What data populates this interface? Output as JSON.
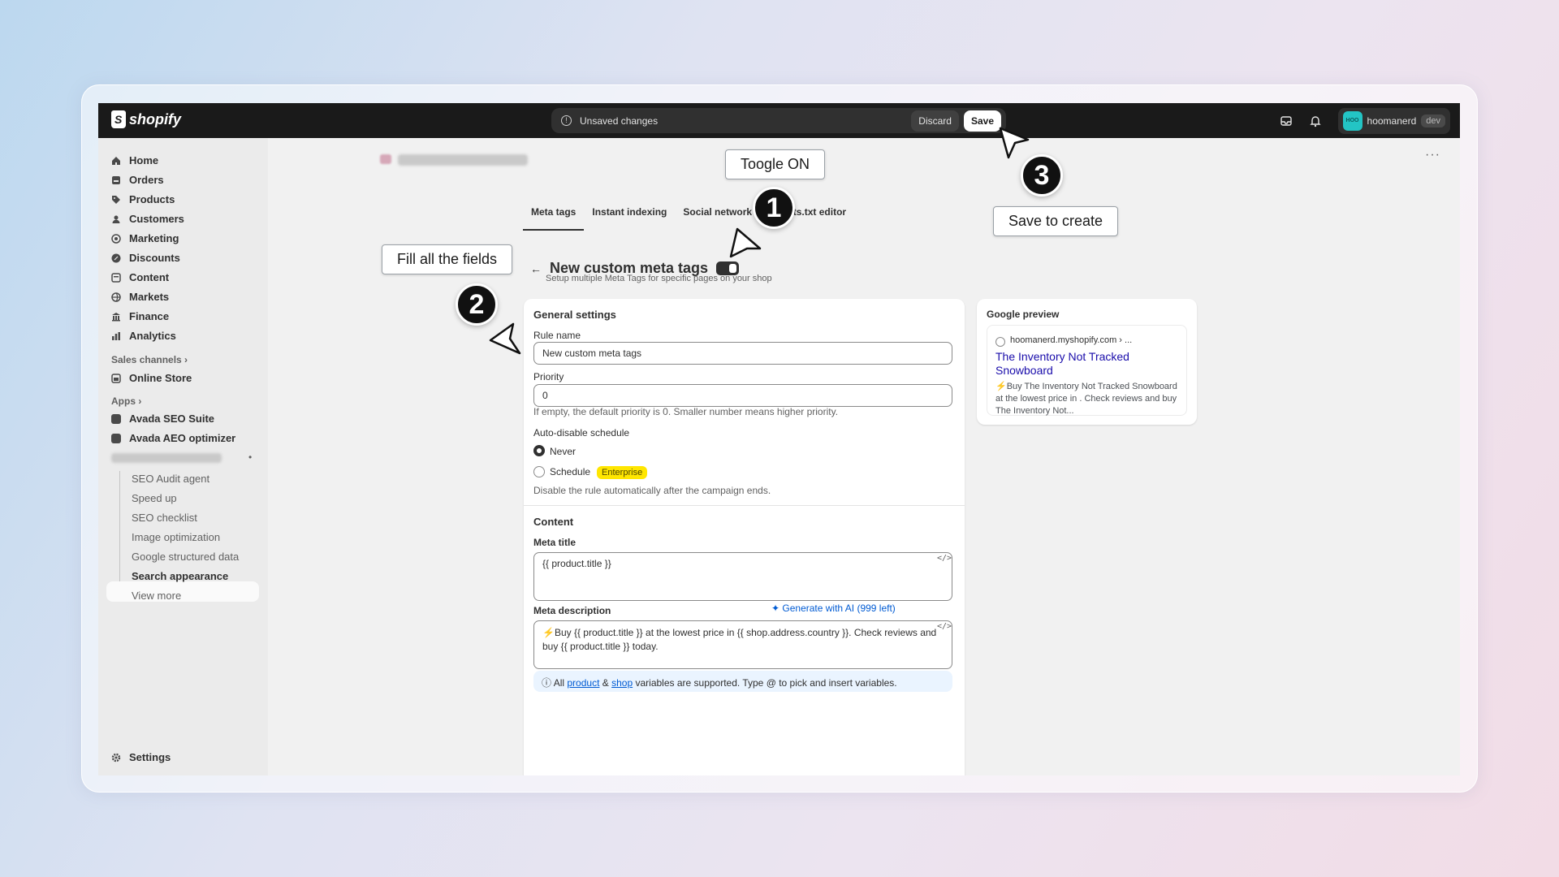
{
  "topbar": {
    "brand": "shopify",
    "unsaved_text": "Unsaved changes",
    "discard_label": "Discard",
    "save_label": "Save",
    "user_name": "hoomanerd",
    "user_badge": "dev",
    "avatar_initials": "HOO"
  },
  "sidebar": {
    "items": [
      {
        "label": "Home",
        "icon": "home-icon"
      },
      {
        "label": "Orders",
        "icon": "inbox-icon"
      },
      {
        "label": "Products",
        "icon": "tag-icon"
      },
      {
        "label": "Customers",
        "icon": "person-icon"
      },
      {
        "label": "Marketing",
        "icon": "target-icon"
      },
      {
        "label": "Discounts",
        "icon": "discount-icon"
      },
      {
        "label": "Content",
        "icon": "content-icon"
      },
      {
        "label": "Markets",
        "icon": "globe-icon"
      },
      {
        "label": "Finance",
        "icon": "bank-icon"
      },
      {
        "label": "Analytics",
        "icon": "chart-icon"
      }
    ],
    "sales_channels_header": "Sales channels",
    "online_store": "Online Store",
    "apps_header": "Apps",
    "apps": [
      "Avada SEO Suite",
      "Avada AEO optimizer"
    ],
    "sub_items": [
      "SEO Audit agent",
      "Speed up",
      "SEO checklist",
      "Image optimization",
      "Google structured data",
      "Search appearance",
      "View more"
    ],
    "settings": "Settings"
  },
  "tabs": [
    "Meta tags",
    "Instant indexing",
    "Social network",
    "Robots.txt editor"
  ],
  "page": {
    "title": "New custom meta tags",
    "subtitle": "Setup multiple Meta Tags for specific pages on your shop"
  },
  "general": {
    "heading": "General settings",
    "rule_name_label": "Rule name",
    "rule_name_value": "New custom meta tags",
    "priority_label": "Priority",
    "priority_value": "0",
    "priority_hint": "If empty, the default priority is 0. Smaller number means higher priority.",
    "schedule_label": "Auto-disable schedule",
    "option_never": "Never",
    "option_schedule": "Schedule",
    "enterprise_badge": "Enterprise",
    "schedule_hint": "Disable the rule automatically after the campaign ends."
  },
  "content": {
    "heading": "Content",
    "meta_title_label": "Meta title",
    "meta_title_value": "{{ product.title }}",
    "meta_desc_label": "Meta description",
    "generate_ai": "Generate with AI (999 left)",
    "meta_desc_value": "⚡Buy {{ product.title }} at the lowest price in {{ shop.address.country }}. Check reviews and buy {{ product.title }} today.",
    "info_all": "All",
    "info_product": "product",
    "info_amp": "&",
    "info_shop": "shop",
    "info_rest": "variables are supported. Type @ to pick and insert variables."
  },
  "google_preview": {
    "heading": "Google preview",
    "url": "hoomanerd.myshopify.com › ...",
    "title": "The Inventory Not Tracked Snowboard",
    "description": "⚡Buy The Inventory Not Tracked Snowboard at the lowest price in . Check reviews and buy The Inventory Not..."
  },
  "annotations": {
    "step1_label": "Toogle ON",
    "step2_label": "Fill all the fields",
    "step3_label": "Save to create",
    "n1": "1",
    "n2": "2",
    "n3": "3"
  },
  "colors": {
    "topbar": "#1a1a1a",
    "accent_link": "#005bd3",
    "enterprise_badge": "#ffe600",
    "avatar": "#23c4c4"
  }
}
